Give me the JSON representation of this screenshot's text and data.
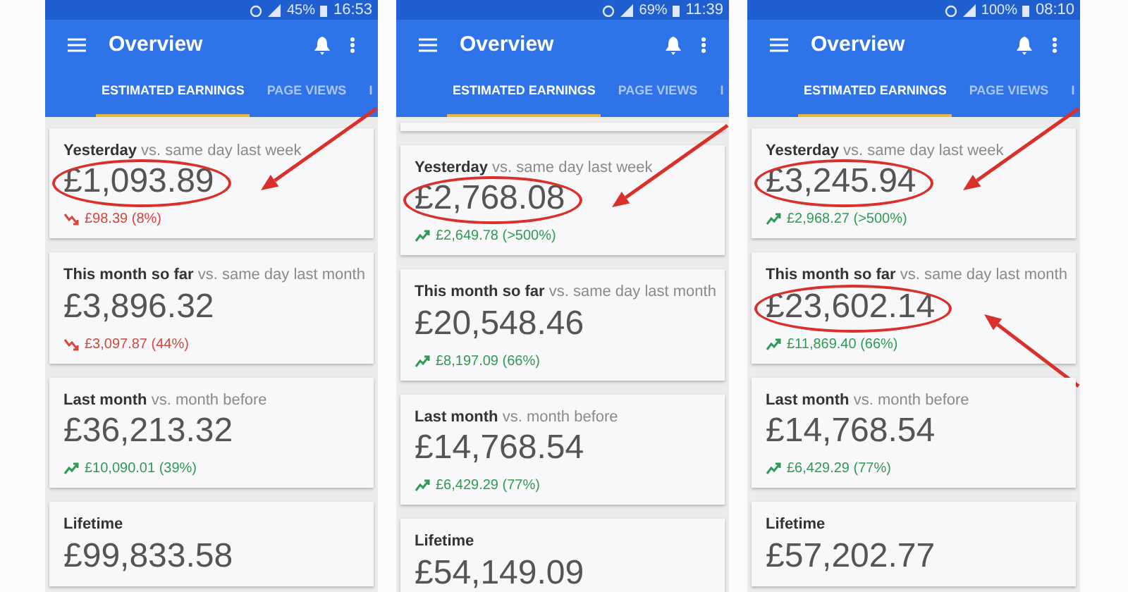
{
  "phones": [
    {
      "status": {
        "battery": "45%",
        "time": "16:53"
      },
      "title": "Overview",
      "tabs": [
        {
          "label": "ESTIMATED EARNINGS",
          "selected": true
        },
        {
          "label": "PAGE VIEWS",
          "selected": false
        },
        {
          "label": "I",
          "selected": false
        }
      ],
      "cut_card_above": false,
      "cards": [
        {
          "heading": "**Yesterday** vs. same day last week",
          "amount": "£1,093.89",
          "change": {
            "text": "£98.39 (8%)",
            "kind": "fall"
          },
          "circled": true,
          "arrow": {
            "kind": "above"
          }
        },
        {
          "heading": "**This month so far** vs. same day last month",
          "amount": "£3,896.32",
          "change": {
            "text": "£3,097.87 (44%)",
            "kind": "fall"
          },
          "circled": false
        },
        {
          "heading": "**Last month** vs. month before",
          "amount": "£36,213.32",
          "change": {
            "text": "£10,090.01 (39%)",
            "kind": "rise"
          },
          "circled": false
        },
        {
          "heading": "**Lifetime**",
          "amount": "£99,833.58",
          "circled": false
        }
      ]
    },
    {
      "status": {
        "battery": "69%",
        "time": "11:39"
      },
      "title": "Overview",
      "tabs": [
        {
          "label": "ESTIMATED EARNINGS",
          "selected": true
        },
        {
          "label": "PAGE VIEWS",
          "selected": false
        },
        {
          "label": "I",
          "selected": false
        }
      ],
      "cut_card_above": true,
      "cards": [
        {
          "heading": "**Yesterday** vs. same day last week",
          "amount": "£2,768.08",
          "change": {
            "text": "£2,649.78 (>500%)",
            "kind": "rise"
          },
          "circled": true,
          "arrow": {
            "kind": "above"
          }
        },
        {
          "heading": "**This month so far** vs. same day last month",
          "amount": "£20,548.46",
          "change": {
            "text": "£8,197.09 (66%)",
            "kind": "rise"
          },
          "circled": false
        },
        {
          "heading": "**Last month** vs. month before",
          "amount": "£14,768.54",
          "change": {
            "text": "£6,429.29 (77%)",
            "kind": "rise"
          },
          "circled": false
        },
        {
          "heading": "**Lifetime**",
          "amount": "£54,149.09",
          "circled": false
        }
      ]
    },
    {
      "status": {
        "battery": "100%",
        "time": "08:10"
      },
      "title": "Overview",
      "tabs": [
        {
          "label": "ESTIMATED EARNINGS",
          "selected": true
        },
        {
          "label": "PAGE VIEWS",
          "selected": false
        },
        {
          "label": "I",
          "selected": false
        }
      ],
      "cut_card_above": false,
      "cards": [
        {
          "heading": "**Yesterday** vs. same day last week",
          "amount": "£3,245.94",
          "change": {
            "text": "£2,968.27 (>500%)",
            "kind": "rise"
          },
          "circled": true,
          "arrow": {
            "kind": "above"
          }
        },
        {
          "heading": "**This month so far** vs. same day last month",
          "amount": "£23,602.14",
          "change": {
            "text": "£11,869.40 (66%)",
            "kind": "rise"
          },
          "circled": true,
          "arrow": {
            "kind": "below"
          }
        },
        {
          "heading": "**Last month** vs. month before",
          "amount": "£14,768.54",
          "change": {
            "text": "£6,429.29 (77%)",
            "kind": "rise"
          },
          "circled": false
        },
        {
          "heading": "**Lifetime**",
          "amount": "£57,202.77",
          "circled": false
        }
      ]
    }
  ]
}
